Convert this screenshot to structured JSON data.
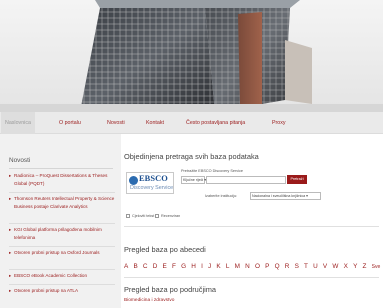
{
  "nav": {
    "items": [
      {
        "label": "Naslovnica",
        "active": true
      },
      {
        "label": "O portalu",
        "active": false
      },
      {
        "label": "Novosti",
        "active": false
      },
      {
        "label": "Kontakt",
        "active": false
      },
      {
        "label": "Često postavljana pitanja",
        "active": false
      },
      {
        "label": "Proxy",
        "active": false
      }
    ]
  },
  "sidebar": {
    "title": "Novosti",
    "items": [
      {
        "label": "Radionica – ProQuest Dissertations & Theses Global (PQDT)"
      },
      {
        "label": "Thomson Reuters Intellectual Property & Science Business postaje Clarivate Analytics"
      },
      {
        "label": "KGI Global platforma prilagođena mobilnim telefonima"
      },
      {
        "label": "Otvoren probni pristup na Oxford Journals"
      },
      {
        "label": "EBSCO eBook Academic Collection"
      },
      {
        "label": "Otvoren probni pristup na ATLA"
      }
    ]
  },
  "main": {
    "discovery_title": "Objedinjena pretraga svih baza podataka",
    "eds": {
      "logo_word": "EBSCO",
      "logo_sub": "Discovery Service",
      "search_label": "Pretražite EBSCO Discovery Service",
      "keyword_select": "Ključne riječi",
      "search_button": "Pretraži",
      "institution_label": "Izaberite instituciju:",
      "institution_select": "Nacionalna i sveučilišna knjižnica",
      "fulltext_label": "Cjeloviti tekst",
      "peer_label": "Recenziran"
    },
    "alpha_title": "Pregled baza po abecedi",
    "alphabet": [
      "A",
      "B",
      "C",
      "D",
      "E",
      "F",
      "G",
      "H",
      "I",
      "J",
      "K",
      "L",
      "M",
      "N",
      "O",
      "P",
      "Q",
      "R",
      "S",
      "T",
      "U",
      "V",
      "W",
      "X",
      "Y",
      "Z",
      "Sve"
    ],
    "area_title": "Pregled baza po područjima",
    "first_area": "Biomedicina i zdravstvo"
  },
  "colors": {
    "accent": "#9a1a1a",
    "nav_bg": "#eaeaea",
    "sidebar_bg": "#f1f1f1",
    "ebsco_blue": "#1c4f8f"
  }
}
